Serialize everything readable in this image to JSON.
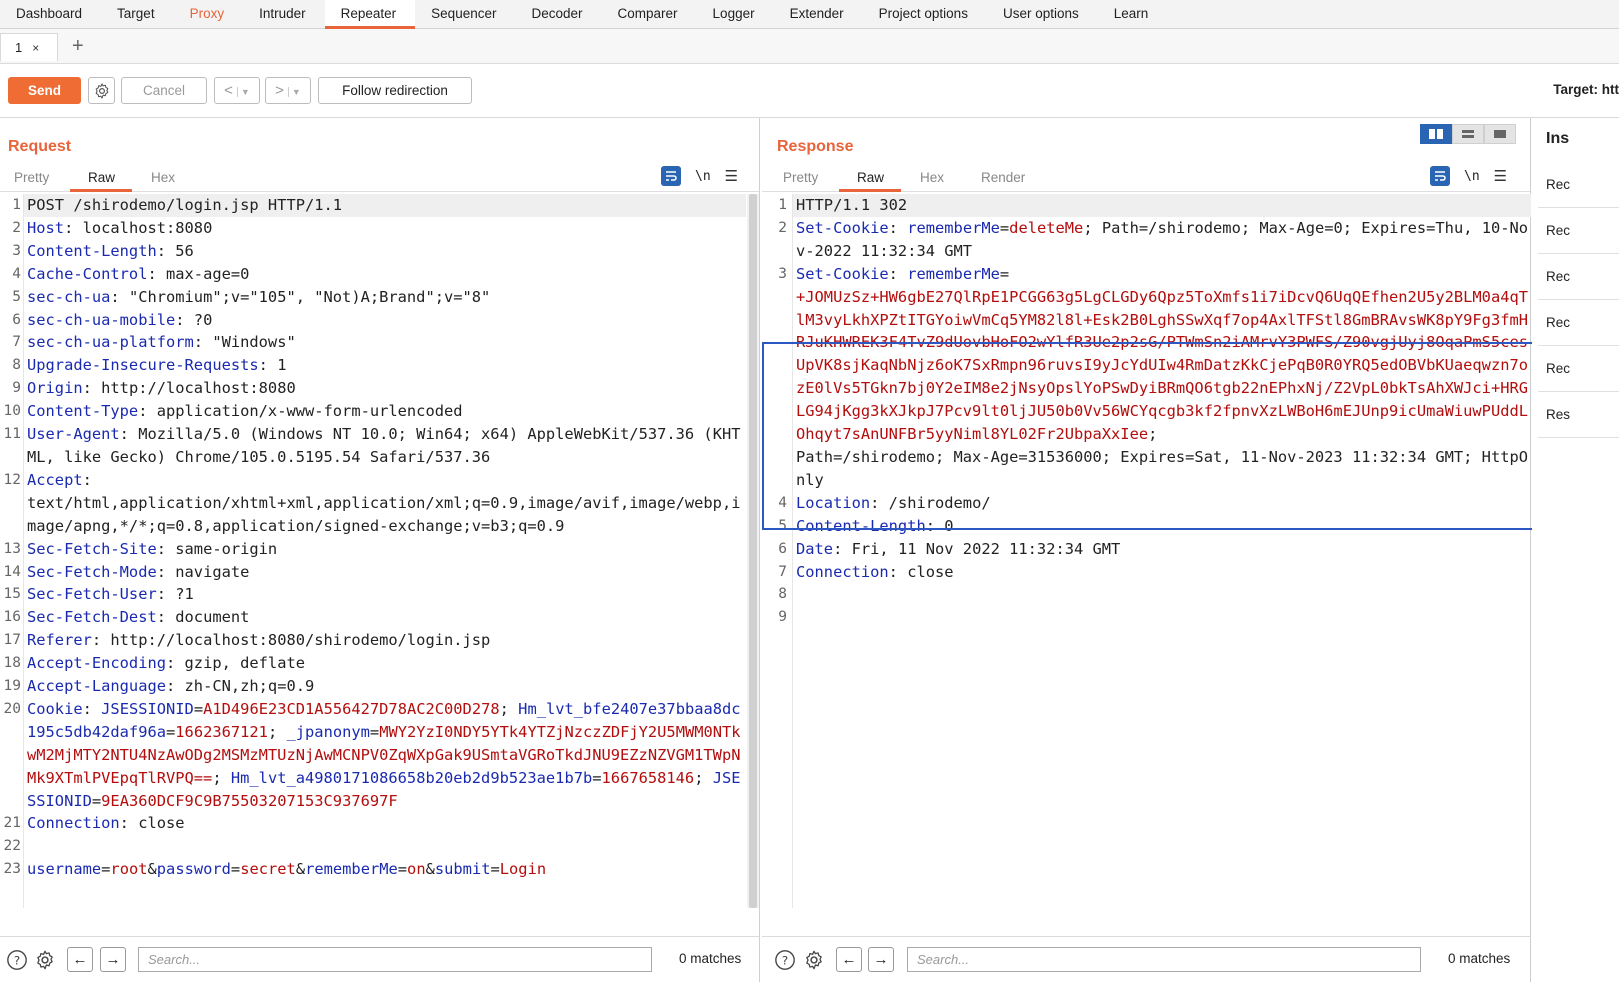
{
  "menu": [
    "Dashboard",
    "Target",
    "Proxy",
    "Intruder",
    "Repeater",
    "Sequencer",
    "Decoder",
    "Comparer",
    "Logger",
    "Extender",
    "Project options",
    "User options",
    "Learn"
  ],
  "tab": {
    "label": "1",
    "close": "×",
    "add": "+"
  },
  "toolbar": {
    "send": "Send",
    "cancel": "Cancel",
    "back": "<",
    "forward": ">",
    "follow": "Follow redirection",
    "target": "Target: htt"
  },
  "request": {
    "title": "Request",
    "tabs": [
      "Pretty",
      "Raw",
      "Hex"
    ],
    "newline_toggle": "\\n",
    "lines": [
      {
        "n": "1",
        "parts": [
          [
            "v",
            "POST /shirodemo/login.jsp HTTP/1.1"
          ]
        ]
      },
      {
        "n": "2",
        "parts": [
          [
            "k",
            "Host"
          ],
          [
            "v",
            ": localhost:8080"
          ]
        ]
      },
      {
        "n": "3",
        "parts": [
          [
            "k",
            "Content-Length"
          ],
          [
            "v",
            ": 56"
          ]
        ]
      },
      {
        "n": "4",
        "parts": [
          [
            "k",
            "Cache-Control"
          ],
          [
            "v",
            ": max-age=0"
          ]
        ]
      },
      {
        "n": "5",
        "parts": [
          [
            "k",
            "sec-ch-ua"
          ],
          [
            "v",
            ": \"Chromium\";v=\"105\", \"Not)A;Brand\";v=\"8\""
          ]
        ]
      },
      {
        "n": "6",
        "parts": [
          [
            "k",
            "sec-ch-ua-mobile"
          ],
          [
            "v",
            ": ?0"
          ]
        ]
      },
      {
        "n": "7",
        "parts": [
          [
            "k",
            "sec-ch-ua-platform"
          ],
          [
            "v",
            ": \"Windows\""
          ]
        ]
      },
      {
        "n": "8",
        "parts": [
          [
            "k",
            "Upgrade-Insecure-Requests"
          ],
          [
            "v",
            ": 1"
          ]
        ]
      },
      {
        "n": "9",
        "parts": [
          [
            "k",
            "Origin"
          ],
          [
            "v",
            ": http://localhost:8080"
          ]
        ]
      },
      {
        "n": "10",
        "parts": [
          [
            "k",
            "Content-Type"
          ],
          [
            "v",
            ": application/x-www-form-urlencoded"
          ]
        ]
      },
      {
        "n": "11",
        "parts": [
          [
            "k",
            "User-Agent"
          ],
          [
            "v",
            ": Mozilla/5.0 (Windows NT 10.0; Win64; x64) AppleWebKit/537.36 (KHTML, like Gecko) Chrome/105.0.5195.54 Safari/537.36"
          ]
        ]
      },
      {
        "n": "12",
        "parts": [
          [
            "k",
            "Accept"
          ],
          [
            "v",
            ":\ntext/html,application/xhtml+xml,application/xml;q=0.9,image/avif,image/webp,image/apng,*/*;q=0.8,application/signed-exchange;v=b3;q=0.9"
          ]
        ]
      },
      {
        "n": "13",
        "parts": [
          [
            "k",
            "Sec-Fetch-Site"
          ],
          [
            "v",
            ": same-origin"
          ]
        ]
      },
      {
        "n": "14",
        "parts": [
          [
            "k",
            "Sec-Fetch-Mode"
          ],
          [
            "v",
            ": navigate"
          ]
        ]
      },
      {
        "n": "15",
        "parts": [
          [
            "k",
            "Sec-Fetch-User"
          ],
          [
            "v",
            ": ?1"
          ]
        ]
      },
      {
        "n": "16",
        "parts": [
          [
            "k",
            "Sec-Fetch-Dest"
          ],
          [
            "v",
            ": document"
          ]
        ]
      },
      {
        "n": "17",
        "parts": [
          [
            "k",
            "Referer"
          ],
          [
            "v",
            ": http://localhost:8080/shirodemo/login.jsp"
          ]
        ]
      },
      {
        "n": "18",
        "parts": [
          [
            "k",
            "Accept-Encoding"
          ],
          [
            "v",
            ": gzip, deflate"
          ]
        ]
      },
      {
        "n": "19",
        "parts": [
          [
            "k",
            "Accept-Language"
          ],
          [
            "v",
            ": zh-CN,zh;q=0.9"
          ]
        ]
      },
      {
        "n": "20",
        "parts": [
          [
            "k",
            "Cookie"
          ],
          [
            "v",
            ": "
          ],
          [
            "k",
            "JSESSIONID"
          ],
          [
            "v",
            "="
          ],
          [
            "r",
            "A1D496E23CD1A556427D78AC2C00D278"
          ],
          [
            "v",
            "; "
          ],
          [
            "k",
            "Hm_lvt_bfe2407e37bbaa8dc195c5db42daf96a"
          ],
          [
            "v",
            "="
          ],
          [
            "r",
            "1662367121"
          ],
          [
            "v",
            "; "
          ],
          [
            "k",
            "_jpanonym"
          ],
          [
            "v",
            "="
          ],
          [
            "r",
            "MWY2YzI0NDY5YTk4YTZjNzczZDFjY2U5MWM0NTkwM2MjMTY2NTU4NzAwODg2MSMzMTUzNjAwMCNPV0ZqWXpGak9USmtaVGRoTkdJNU9EZzNZVGM1TWpNMk9XTmlPVEpqTlRVPQ=="
          ],
          [
            "v",
            "; "
          ],
          [
            "k",
            "Hm_lvt_a4980171086658b20eb2d9b523ae1b7b"
          ],
          [
            "v",
            "="
          ],
          [
            "r",
            "1667658146"
          ],
          [
            "v",
            "; "
          ],
          [
            "k",
            "JSESSIONID"
          ],
          [
            "v",
            "="
          ],
          [
            "r",
            "9EA360DCF9C9B75503207153C937697F"
          ]
        ]
      },
      {
        "n": "21",
        "parts": [
          [
            "k",
            "Connection"
          ],
          [
            "v",
            ": close"
          ]
        ]
      },
      {
        "n": "22",
        "parts": [
          [
            "v",
            ""
          ]
        ]
      },
      {
        "n": "23",
        "parts": [
          [
            "k",
            "username"
          ],
          [
            "v",
            "="
          ],
          [
            "r",
            "root"
          ],
          [
            "v",
            "&"
          ],
          [
            "k",
            "password"
          ],
          [
            "v",
            "="
          ],
          [
            "r",
            "secret"
          ],
          [
            "v",
            "&"
          ],
          [
            "k",
            "rememberMe"
          ],
          [
            "v",
            "="
          ],
          [
            "r",
            "on"
          ],
          [
            "v",
            "&"
          ],
          [
            "k",
            "submit"
          ],
          [
            "v",
            "="
          ],
          [
            "r",
            "Login"
          ]
        ]
      }
    ],
    "search_placeholder": "Search...",
    "matches": "0 matches"
  },
  "response": {
    "title": "Response",
    "tabs": [
      "Pretty",
      "Raw",
      "Hex",
      "Render"
    ],
    "newline_toggle": "\\n",
    "lines": [
      {
        "n": "1",
        "parts": [
          [
            "v",
            "HTTP/1.1 302"
          ]
        ]
      },
      {
        "n": "2",
        "parts": [
          [
            "k",
            "Set-Cookie"
          ],
          [
            "v",
            ": "
          ],
          [
            "k",
            "rememberMe"
          ],
          [
            "v",
            "="
          ],
          [
            "r",
            "deleteMe"
          ],
          [
            "v",
            "; Path=/shirodemo; Max-Age=0; Expires=Thu, 10-Nov-2022 11:32:34 GMT"
          ]
        ]
      },
      {
        "n": "3",
        "parts": [
          [
            "k",
            "Set-Cookie"
          ],
          [
            "v",
            ": "
          ],
          [
            "k",
            "rememberMe"
          ],
          [
            "v",
            "=\n"
          ],
          [
            "r",
            "+JOMUzSz+HW6gbE27QlRpE1PCGG63g5LgCLGDy6Qpz5ToXmfs1i7iDcvQ6UqQEfhen2U5y2BLM0a4qTlM3vyLkhXPZtITGYoiwVmCq5YM82l8l+Esk2B0LghSSwXqf7op4AxlTFStl8GmBRAvsWK8pY9Fg3fmHRJuKHWREK3F4TvZ9dUovbHoFO2wYlfR3Ue2p2sG/PTWmSn2iAMrvY3PWFS/Z90vgjUyj8OqaPmS5cesUpVK8sjKaqNbNjz6oK7SxRmpn96ruvsI9yJcYdUIw4RmDatzKkCjePqB0R0YRQ5edOBVbKUaeqwzn7ozE0lVs5TGkn7bj0Y2eIM8e2jNsyOpslYoPSwDyiBRmQO6tgb22nEPhxNj/Z2VpL0bkTsAhXWJci+HRGLG94jKgg3kXJkpJ7Pcv9lt0ljJU50b0Vv56WCYqcgb3kf2fpnvXzLWBoH6mEJUnp9icUmaWiuwPUddLOhqyt7sAnUNFBr5yyNiml8YL02Fr2UbpaXxIee"
          ],
          [
            "v",
            ";\nPath=/shirodemo; Max-Age=31536000; Expires=Sat, 11-Nov-2023 11:32:34 GMT; HttpOnly"
          ]
        ]
      },
      {
        "n": "4",
        "parts": [
          [
            "k",
            "Location"
          ],
          [
            "v",
            ": /shirodemo/"
          ]
        ]
      },
      {
        "n": "5",
        "parts": [
          [
            "k",
            "Content-Length"
          ],
          [
            "v",
            ": 0"
          ]
        ]
      },
      {
        "n": "6",
        "parts": [
          [
            "k",
            "Date"
          ],
          [
            "v",
            ": Fri, 11 Nov 2022 11:32:34 GMT"
          ]
        ]
      },
      {
        "n": "7",
        "parts": [
          [
            "k",
            "Connection"
          ],
          [
            "v",
            ": close"
          ]
        ]
      },
      {
        "n": "8",
        "parts": [
          [
            "v",
            ""
          ]
        ]
      },
      {
        "n": "9",
        "parts": [
          [
            "v",
            ""
          ]
        ]
      }
    ],
    "search_placeholder": "Search...",
    "matches": "0 matches"
  },
  "inspector": {
    "title": "Ins",
    "items": [
      "Rec",
      "Rec",
      "Rec",
      "Rec",
      "Rec",
      "Res"
    ]
  },
  "colors": {
    "accent": "#e8643a",
    "send": "#ef6c35",
    "key": "#1a2ab0",
    "value_red": "#b30d0d",
    "highlight_box": "#2d58c4",
    "toggle_blue": "#2a65b4"
  }
}
